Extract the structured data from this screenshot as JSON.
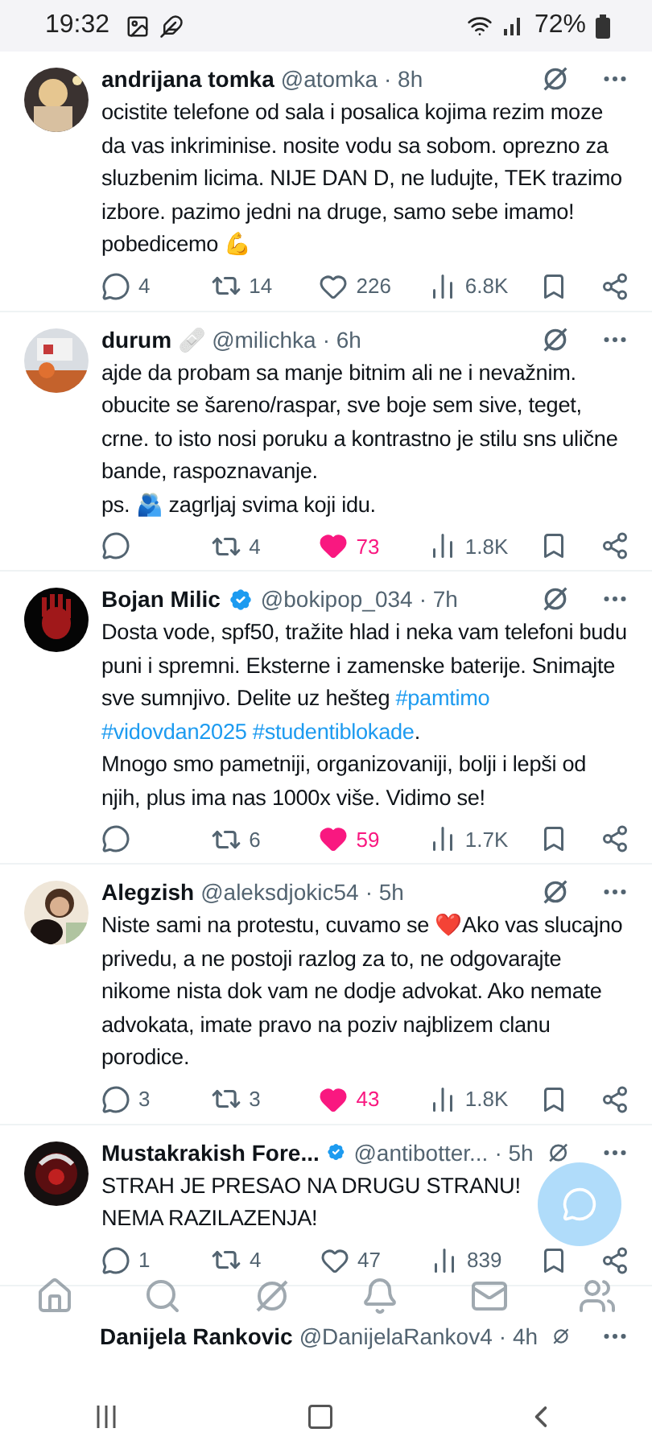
{
  "status_bar": {
    "time": "19:32",
    "battery": "72%"
  },
  "tweets": [
    {
      "name": "andrijana tomka",
      "verified": false,
      "handle": "@atomka",
      "time": "· 8h",
      "body": [
        {
          "kind": "text",
          "text": "ocistite telefone od sala i posalica kojima rezim moze da vas inkriminise. nosite vodu sa sobom. oprezno za sluzbenim licima. NIJE DAN D, ne ludujte, TEK trazimo izbore. pazimo jedni na druge, samo sebe imamo! pobedicemo 💪"
        }
      ],
      "replies": "4",
      "reposts": "14",
      "likes": "226",
      "liked": false,
      "views": "6.8K"
    },
    {
      "name": "durum",
      "badge": "🩹",
      "verified": false,
      "handle": "@milichka",
      "time": "· 6h",
      "body": [
        {
          "kind": "text",
          "text": "ajde da probam sa manje bitnim ali ne i nevažnim. obucite se šareno/raspar, sve boje sem sive, teget, crne. to isto nosi poruku a kontrastno je stilu sns ulične bande, raspoznavanje.\nps. 🫂 zagrljaj svima koji idu."
        }
      ],
      "reposts": "4",
      "likes": "73",
      "liked": true,
      "views": "1.8K"
    },
    {
      "name": "Bojan Milic",
      "verified": true,
      "handle": "@bokipop_034",
      "time": "· 7h",
      "body": [
        {
          "kind": "text",
          "text": "Dosta vode, spf50, tražite hlad i neka vam telefoni budu puni i spremni. Eksterne i zamenske baterije. Snimajte sve sumnjivo. Delite uz hešteg "
        },
        {
          "kind": "hashtag",
          "text": "#pamtimo"
        },
        {
          "kind": "hashtag",
          "text": "#vidovdan2025"
        },
        {
          "kind": "hashtag",
          "text": "#studentiblokade"
        },
        {
          "kind": "text",
          "text": ".\nMnogo smo pametniji, organizovaniji, bolji i lepši od njih, plus ima nas 1000x više. Vidimo se!"
        }
      ],
      "reposts": "6",
      "likes": "59",
      "liked": true,
      "views": "1.7K"
    },
    {
      "name": "Alegzish",
      "verified": false,
      "handle": "@aleksdjokic54",
      "time": "· 5h",
      "body": [
        {
          "kind": "text",
          "text": "Niste sami na protestu, cuvamo se ❤️Ako vas slucajno privedu, a ne postoji razlog za to, ne odgovarajte nikome nista dok vam ne dodje advokat. Ako nemate advokata, imate pravo na poziv najblizem clanu porodice."
        }
      ],
      "replies": "3",
      "reposts": "3",
      "likes": "43",
      "liked": true,
      "views": "1.8K"
    },
    {
      "name": "Mustakrakish Fore...",
      "verified": true,
      "handle": "@antibotter...",
      "time": "· 5h",
      "body": [
        {
          "kind": "text",
          "text": "STRAH JE PRESAO NA DRUGU STRANU! NEMA RAZILAZENJA!"
        }
      ],
      "replies": "1",
      "reposts": "4",
      "likes": "47",
      "liked": false,
      "views": "839"
    }
  ],
  "partial_tweet": {
    "name": "Danijela Rankovic",
    "handle": "@DanijelaRankov4",
    "time": "· 4h"
  },
  "bottom_nav": [
    {
      "kind": "home",
      "selected": false
    },
    {
      "kind": "search",
      "selected": false
    },
    {
      "kind": "grok",
      "selected": false
    },
    {
      "kind": "bell",
      "selected": false
    },
    {
      "kind": "mail",
      "selected": false
    },
    {
      "kind": "people",
      "selected": false
    }
  ]
}
